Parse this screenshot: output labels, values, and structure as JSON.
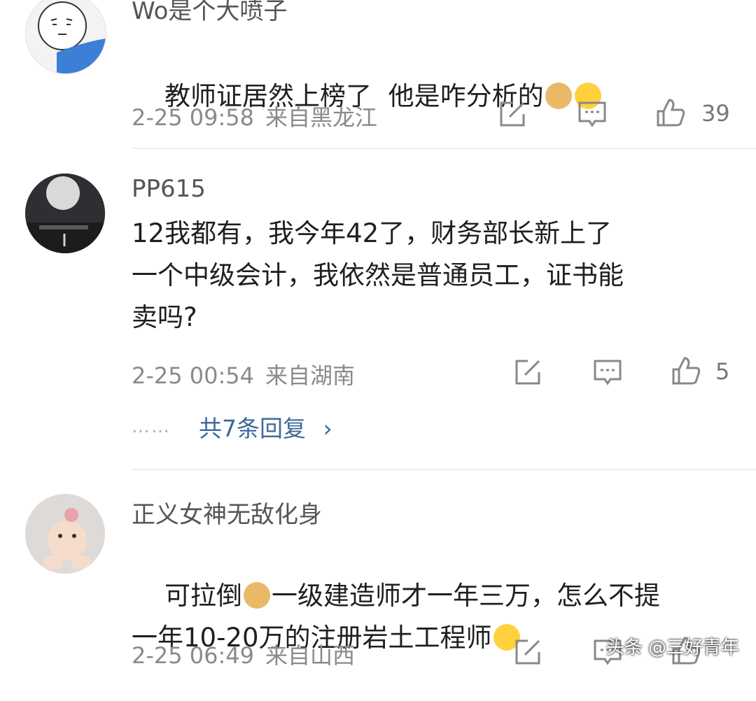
{
  "comments": [
    {
      "username": "Wo是个大喷子",
      "text_parts": [
        "教师证居然上榜了  他是咋分析的",
        "",
        ""
      ],
      "time": "2-25 09:58",
      "location": "来自黑龙江",
      "likes": "39",
      "avatar_icon": "cartoon-face-avatar"
    },
    {
      "username": "PP615",
      "text": "12我都有，我今年42了，财务部长新上了\n一个中级会计，我依然是普通员工，证书能\n卖吗?",
      "time": "2-25 00:54",
      "location": "来自湖南",
      "likes": "5",
      "avatar_icon": "moon-night-avatar",
      "replies": {
        "dots": "……",
        "label": "共7条回复",
        "arrow": "›"
      }
    },
    {
      "username": "正义女神无敌化身",
      "text_line1_a": "可拉倒",
      "text_line1_b": "一级建造师才一年三万，怎么不提",
      "text_line2": "一年10-20万的注册岩土工程师",
      "time": "2-25 06:49",
      "location": "来自山西",
      "avatar_icon": "baby-photo-avatar"
    }
  ],
  "watermark": "头条 @三好青年",
  "colors": {
    "reply_link": "#3d6a99",
    "meta_gray": "#8a8a8a",
    "divider": "#ececec"
  }
}
